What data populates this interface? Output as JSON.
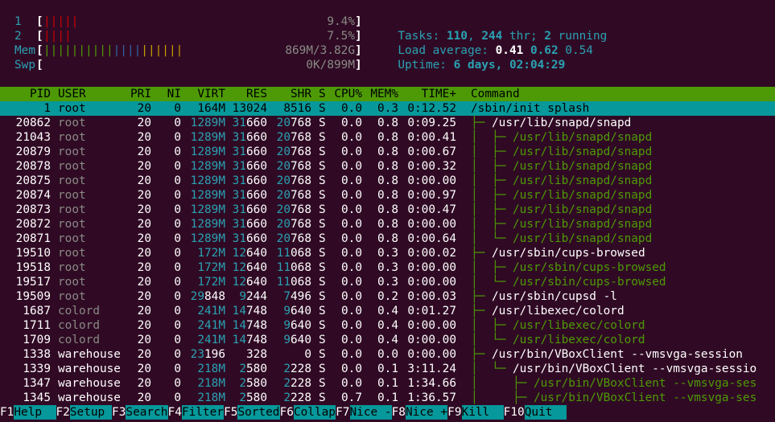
{
  "meters": {
    "cpu1": {
      "label": "1",
      "open": "[",
      "bars": "|||||",
      "value": "9.4%",
      "close": "]"
    },
    "cpu2": {
      "label": "2",
      "open": "[",
      "bars": "||||",
      "value": "7.5%",
      "close": "]"
    },
    "mem": {
      "label": "Mem",
      "open": "[",
      "bars": "||||||||||||||||||||",
      "value": "869M/3.82G",
      "close": "]"
    },
    "swp": {
      "label": "Swp",
      "open": "[",
      "bars": "",
      "value": "0K/899M",
      "close": "]"
    }
  },
  "summary": {
    "tasks_label": "Tasks: ",
    "tasks": "110",
    "comma": ", ",
    "threads": "244",
    "thr_label": " thr; ",
    "running": "2",
    "running_label": " running",
    "load_label": "Load average: ",
    "load1": "0.41",
    "load5": "0.62",
    "load15": "0.54",
    "uptime_label": "Uptime: ",
    "uptime": "6 days, 02:04:29"
  },
  "columns": {
    "pid": "PID",
    "user": "USER",
    "pri": "PRI",
    "ni": "NI",
    "virt": "VIRT",
    "res": "RES",
    "shr": "SHR",
    "s": "S",
    "cpu": "CPU%",
    "mem": "MEM%",
    "time": "TIME+",
    "command": "Command"
  },
  "processes": [
    {
      "pid": "1",
      "user": "root",
      "pri": "20",
      "ni": "0",
      "virt": "164M",
      "res": "13024",
      "shr": "8516",
      "s": "S",
      "cpu": "0.0",
      "mem": "0.3",
      "time": "0:12.52",
      "tree": "",
      "cmd": "/sbin/init splash",
      "selected": true,
      "child": false
    },
    {
      "pid": "20862",
      "user": "root",
      "pri": "20",
      "ni": "0",
      "virt": "1289M",
      "res": "31660",
      "shr": "20768",
      "s": "S",
      "cpu": "0.0",
      "mem": "0.8",
      "time": "0:09.25",
      "tree": "├─ ",
      "cmd": "/usr/lib/snapd/snapd",
      "selected": false,
      "child": false
    },
    {
      "pid": "21043",
      "user": "root",
      "pri": "20",
      "ni": "0",
      "virt": "1289M",
      "res": "31660",
      "shr": "20768",
      "s": "S",
      "cpu": "0.0",
      "mem": "0.8",
      "time": "0:00.41",
      "tree": "│  ├─ ",
      "cmd": "/usr/lib/snapd/snapd",
      "selected": false,
      "child": true
    },
    {
      "pid": "20879",
      "user": "root",
      "pri": "20",
      "ni": "0",
      "virt": "1289M",
      "res": "31660",
      "shr": "20768",
      "s": "S",
      "cpu": "0.0",
      "mem": "0.8",
      "time": "0:00.67",
      "tree": "│  ├─ ",
      "cmd": "/usr/lib/snapd/snapd",
      "selected": false,
      "child": true
    },
    {
      "pid": "20878",
      "user": "root",
      "pri": "20",
      "ni": "0",
      "virt": "1289M",
      "res": "31660",
      "shr": "20768",
      "s": "S",
      "cpu": "0.0",
      "mem": "0.8",
      "time": "0:00.32",
      "tree": "│  ├─ ",
      "cmd": "/usr/lib/snapd/snapd",
      "selected": false,
      "child": true
    },
    {
      "pid": "20875",
      "user": "root",
      "pri": "20",
      "ni": "0",
      "virt": "1289M",
      "res": "31660",
      "shr": "20768",
      "s": "S",
      "cpu": "0.0",
      "mem": "0.8",
      "time": "0:00.00",
      "tree": "│  ├─ ",
      "cmd": "/usr/lib/snapd/snapd",
      "selected": false,
      "child": true
    },
    {
      "pid": "20874",
      "user": "root",
      "pri": "20",
      "ni": "0",
      "virt": "1289M",
      "res": "31660",
      "shr": "20768",
      "s": "S",
      "cpu": "0.0",
      "mem": "0.8",
      "time": "0:00.97",
      "tree": "│  ├─ ",
      "cmd": "/usr/lib/snapd/snapd",
      "selected": false,
      "child": true
    },
    {
      "pid": "20873",
      "user": "root",
      "pri": "20",
      "ni": "0",
      "virt": "1289M",
      "res": "31660",
      "shr": "20768",
      "s": "S",
      "cpu": "0.0",
      "mem": "0.8",
      "time": "0:00.47",
      "tree": "│  ├─ ",
      "cmd": "/usr/lib/snapd/snapd",
      "selected": false,
      "child": true
    },
    {
      "pid": "20872",
      "user": "root",
      "pri": "20",
      "ni": "0",
      "virt": "1289M",
      "res": "31660",
      "shr": "20768",
      "s": "S",
      "cpu": "0.0",
      "mem": "0.8",
      "time": "0:00.00",
      "tree": "│  ├─ ",
      "cmd": "/usr/lib/snapd/snapd",
      "selected": false,
      "child": true
    },
    {
      "pid": "20871",
      "user": "root",
      "pri": "20",
      "ni": "0",
      "virt": "1289M",
      "res": "31660",
      "shr": "20768",
      "s": "S",
      "cpu": "0.0",
      "mem": "0.8",
      "time": "0:00.64",
      "tree": "│  └─ ",
      "cmd": "/usr/lib/snapd/snapd",
      "selected": false,
      "child": true
    },
    {
      "pid": "19510",
      "user": "root",
      "pri": "20",
      "ni": "0",
      "virt": "172M",
      "res": "12640",
      "shr": "11068",
      "s": "S",
      "cpu": "0.0",
      "mem": "0.3",
      "time": "0:00.02",
      "tree": "├─ ",
      "cmd": "/usr/sbin/cups-browsed",
      "selected": false,
      "child": false
    },
    {
      "pid": "19518",
      "user": "root",
      "pri": "20",
      "ni": "0",
      "virt": "172M",
      "res": "12640",
      "shr": "11068",
      "s": "S",
      "cpu": "0.0",
      "mem": "0.3",
      "time": "0:00.00",
      "tree": "│  ├─ ",
      "cmd": "/usr/sbin/cups-browsed",
      "selected": false,
      "child": true
    },
    {
      "pid": "19517",
      "user": "root",
      "pri": "20",
      "ni": "0",
      "virt": "172M",
      "res": "12640",
      "shr": "11068",
      "s": "S",
      "cpu": "0.0",
      "mem": "0.3",
      "time": "0:00.00",
      "tree": "│  └─ ",
      "cmd": "/usr/sbin/cups-browsed",
      "selected": false,
      "child": true
    },
    {
      "pid": "19509",
      "user": "root",
      "pri": "20",
      "ni": "0",
      "virt": "29848",
      "res": "9244",
      "shr": "7496",
      "s": "S",
      "cpu": "0.0",
      "mem": "0.2",
      "time": "0:00.03",
      "tree": "├─ ",
      "cmd": "/usr/sbin/cupsd -l",
      "selected": false,
      "child": false
    },
    {
      "pid": "1687",
      "user": "colord",
      "pri": "20",
      "ni": "0",
      "virt": "241M",
      "res": "14748",
      "shr": "9640",
      "s": "S",
      "cpu": "0.0",
      "mem": "0.4",
      "time": "0:01.27",
      "tree": "├─ ",
      "cmd": "/usr/libexec/colord",
      "selected": false,
      "child": false
    },
    {
      "pid": "1711",
      "user": "colord",
      "pri": "20",
      "ni": "0",
      "virt": "241M",
      "res": "14748",
      "shr": "9640",
      "s": "S",
      "cpu": "0.0",
      "mem": "0.4",
      "time": "0:00.00",
      "tree": "│  ├─ ",
      "cmd": "/usr/libexec/colord",
      "selected": false,
      "child": true
    },
    {
      "pid": "1709",
      "user": "colord",
      "pri": "20",
      "ni": "0",
      "virt": "241M",
      "res": "14748",
      "shr": "9640",
      "s": "S",
      "cpu": "0.0",
      "mem": "0.4",
      "time": "0:00.00",
      "tree": "│  └─ ",
      "cmd": "/usr/libexec/colord",
      "selected": false,
      "child": true
    },
    {
      "pid": "1338",
      "user": "warehouse",
      "pri": "20",
      "ni": "0",
      "virt": "23196",
      "res": "328",
      "shr": "0",
      "s": "S",
      "cpu": "0.0",
      "mem": "0.0",
      "time": "0:00.00",
      "tree": "├─ ",
      "cmd": "/usr/bin/VBoxClient --vmsvga-session",
      "selected": false,
      "child": false
    },
    {
      "pid": "1339",
      "user": "warehouse",
      "pri": "20",
      "ni": "0",
      "virt": "218M",
      "res": "2580",
      "shr": "2228",
      "s": "S",
      "cpu": "0.0",
      "mem": "0.1",
      "time": "3:11.24",
      "tree": "│  └─ ",
      "cmd": "/usr/bin/VBoxClient --vmsvga-sessio",
      "selected": false,
      "child": false
    },
    {
      "pid": "1347",
      "user": "warehouse",
      "pri": "20",
      "ni": "0",
      "virt": "218M",
      "res": "2580",
      "shr": "2228",
      "s": "S",
      "cpu": "0.0",
      "mem": "0.1",
      "time": "1:34.66",
      "tree": "│     ├─ ",
      "cmd": "/usr/bin/VBoxClient --vmsvga-ses",
      "selected": false,
      "child": true
    },
    {
      "pid": "1345",
      "user": "warehouse",
      "pri": "20",
      "ni": "0",
      "virt": "218M",
      "res": "2580",
      "shr": "2228",
      "s": "S",
      "cpu": "0.7",
      "mem": "0.1",
      "time": "1:36.57",
      "tree": "│     ├─ ",
      "cmd": "/usr/bin/VBoxClient --vmsvga-ses",
      "selected": false,
      "child": true
    }
  ],
  "fkeys": [
    {
      "key": "F1",
      "label": "Help  "
    },
    {
      "key": "F2",
      "label": "Setup "
    },
    {
      "key": "F3",
      "label": "Search"
    },
    {
      "key": "F4",
      "label": "Filter"
    },
    {
      "key": "F5",
      "label": "Sorted"
    },
    {
      "key": "F6",
      "label": "Collap"
    },
    {
      "key": "F7",
      "label": "Nice -"
    },
    {
      "key": "F8",
      "label": "Nice +"
    },
    {
      "key": "F9",
      "label": "Kill  "
    },
    {
      "key": "F10",
      "label": "Quit  "
    }
  ],
  "colors": {
    "background": "#300a24",
    "header_bar": "#4e9a06",
    "selection": "#06989a",
    "cyan": "#2aa1b3",
    "tree_child": "#4e9a06"
  }
}
